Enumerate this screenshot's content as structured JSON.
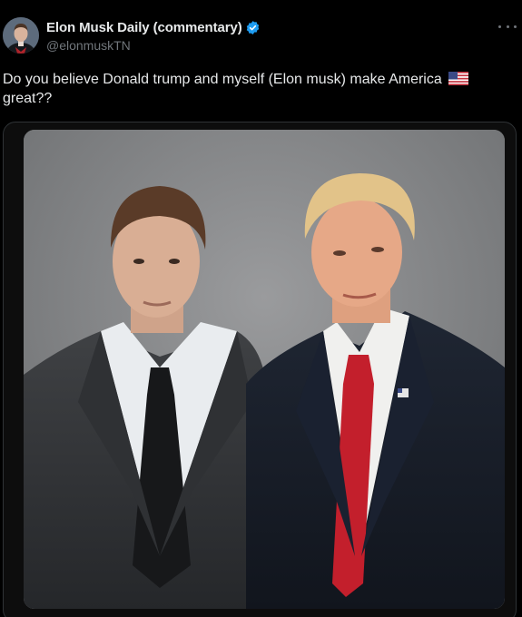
{
  "author": {
    "display_name": "Elon Musk Daily (commentary)",
    "handle": "@elonmuskTN",
    "verified": true,
    "avatar_icon": "profile-photo"
  },
  "tweet": {
    "text": "Do you believe Donald trump and myself (Elon musk) make America",
    "text_end": "great??",
    "emoji": "us-flag-emoji"
  },
  "media": {
    "type": "photo",
    "alt": ""
  },
  "colors": {
    "background": "#000000",
    "text": "#e7e9ea",
    "secondary_text": "#71767b",
    "verified_badge": "#1d9bf0",
    "border": "#2f3336"
  }
}
